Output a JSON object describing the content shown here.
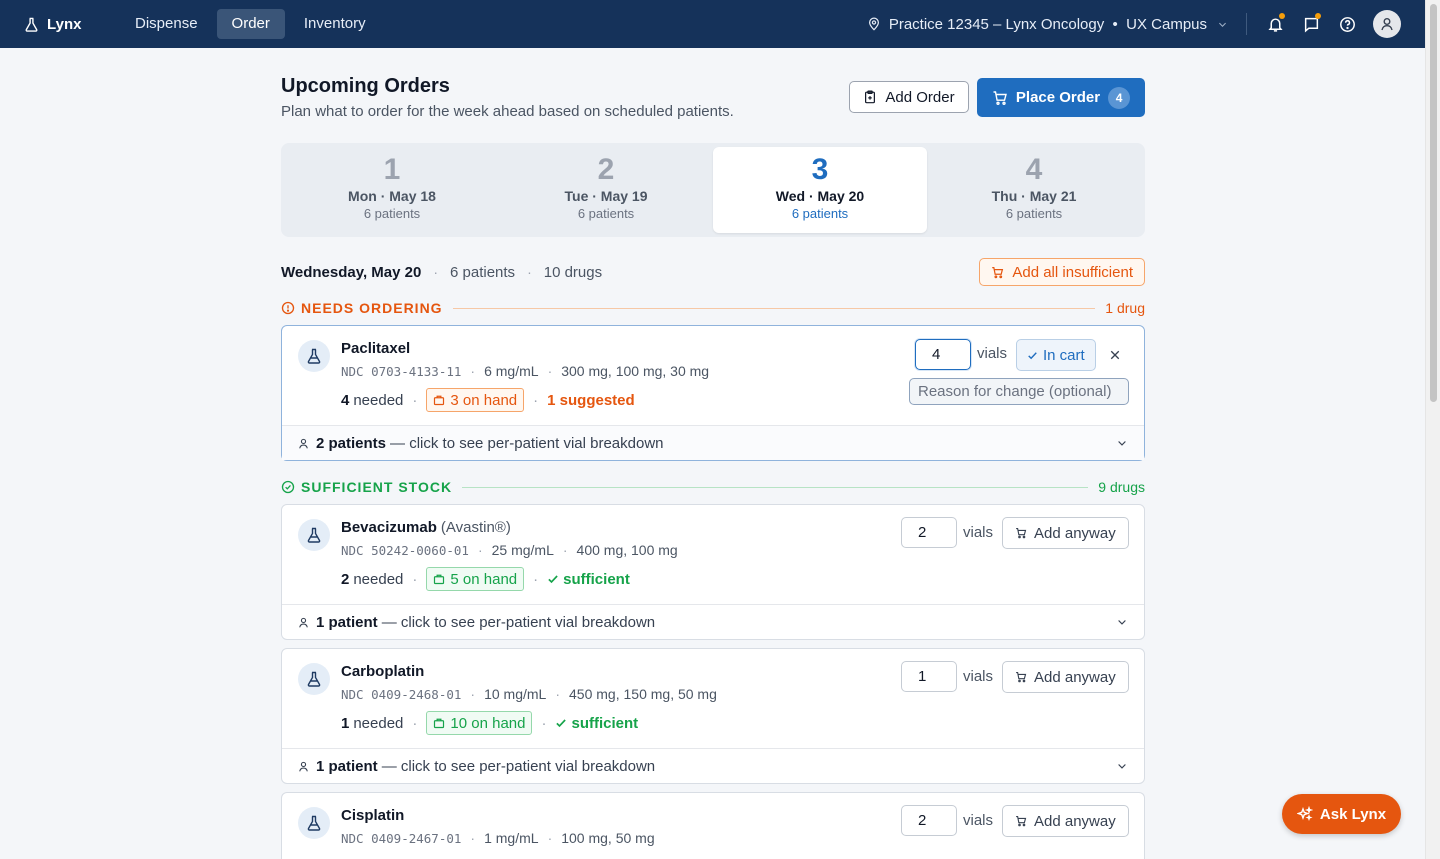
{
  "nav": {
    "brand": "Lynx",
    "tabs": [
      {
        "label": "Dispense",
        "active": false
      },
      {
        "label": "Order",
        "active": true
      },
      {
        "label": "Inventory",
        "active": false
      }
    ],
    "practice": "Practice 12345 – Lynx Oncology  •  UX Campus",
    "notification_dot_color": "#f59e0b"
  },
  "header": {
    "title": "Upcoming Orders",
    "subtitle": "Plan what to order for the week ahead based on scheduled patients.",
    "add_order_label": "Add Order",
    "place_order_label": "Place Order",
    "place_order_count": "4"
  },
  "days": [
    {
      "num": "1",
      "date": "Mon · May 18",
      "patients": "6 patients",
      "active": false
    },
    {
      "num": "2",
      "date": "Tue · May 19",
      "patients": "6 patients",
      "active": false
    },
    {
      "num": "3",
      "date": "Wed · May 20",
      "patients": "6 patients",
      "active": true
    },
    {
      "num": "4",
      "date": "Thu · May 21",
      "patients": "6 patients",
      "active": false
    }
  ],
  "summary": {
    "date": "Wednesday, May 20",
    "patients": "6 patients",
    "drugs": "10 drugs",
    "add_all_label": "Add all insufficient"
  },
  "needs_ordering": {
    "title": "NEEDS ORDERING",
    "count": "1 drug",
    "color": "#e5560f"
  },
  "sufficient_stock": {
    "title": "SUFFICIENT STOCK",
    "count": "9 drugs",
    "color": "#16a34a"
  },
  "drugs": [
    {
      "name": "Paclitaxel",
      "brand": "",
      "ndc": "NDC 0703-4133-11",
      "concentration": "6 mg/mL",
      "sizes": "300 mg, 100 mg, 30 mg",
      "needed_num": "4",
      "needed_txt": "needed",
      "on_hand": "3 on hand",
      "status": "1 suggested",
      "qty": "4",
      "vials": "vials",
      "action": "In cart",
      "reason_placeholder": "Reason for change (optional)",
      "foot_count": "2 patients",
      "foot_txt": "— click to see per-patient vial breakdown"
    },
    {
      "name": "Bevacizumab",
      "brand": "(Avastin®)",
      "ndc": "NDC 50242-0060-01",
      "concentration": "25 mg/mL",
      "sizes": "400 mg, 100 mg",
      "needed_num": "2",
      "needed_txt": "needed",
      "on_hand": "5 on hand",
      "status": "sufficient",
      "qty": "2",
      "vials": "vials",
      "action": "Add anyway",
      "foot_count": "1 patient",
      "foot_txt": "— click to see per-patient vial breakdown"
    },
    {
      "name": "Carboplatin",
      "brand": "",
      "ndc": "NDC 0409-2468-01",
      "concentration": "10 mg/mL",
      "sizes": "450 mg, 150 mg, 50 mg",
      "needed_num": "1",
      "needed_txt": "needed",
      "on_hand": "10 on hand",
      "status": "sufficient",
      "qty": "1",
      "vials": "vials",
      "action": "Add anyway",
      "foot_count": "1 patient",
      "foot_txt": "— click to see per-patient vial breakdown"
    },
    {
      "name": "Cisplatin",
      "brand": "",
      "ndc": "NDC 0409-2467-01",
      "concentration": "1 mg/mL",
      "sizes": "100 mg, 50 mg",
      "qty": "2",
      "vials": "vials",
      "action": "Add anyway"
    }
  ],
  "ask": {
    "label": "Ask Lynx"
  },
  "icons": {
    "brand": "flask-icon",
    "practice": "map-pin-icon",
    "bell": "bell-icon",
    "messages": "message-icon",
    "help": "help-icon",
    "avatar": "user-icon",
    "cart": "cart-icon",
    "clipboard": "clipboard-icon",
    "alert": "alert-circle-icon",
    "check_circle": "check-circle-icon"
  },
  "colors": {
    "nav_bg": "#15325a",
    "primary": "#1f6dbf",
    "warning": "#e5560f",
    "success": "#16a34a"
  }
}
